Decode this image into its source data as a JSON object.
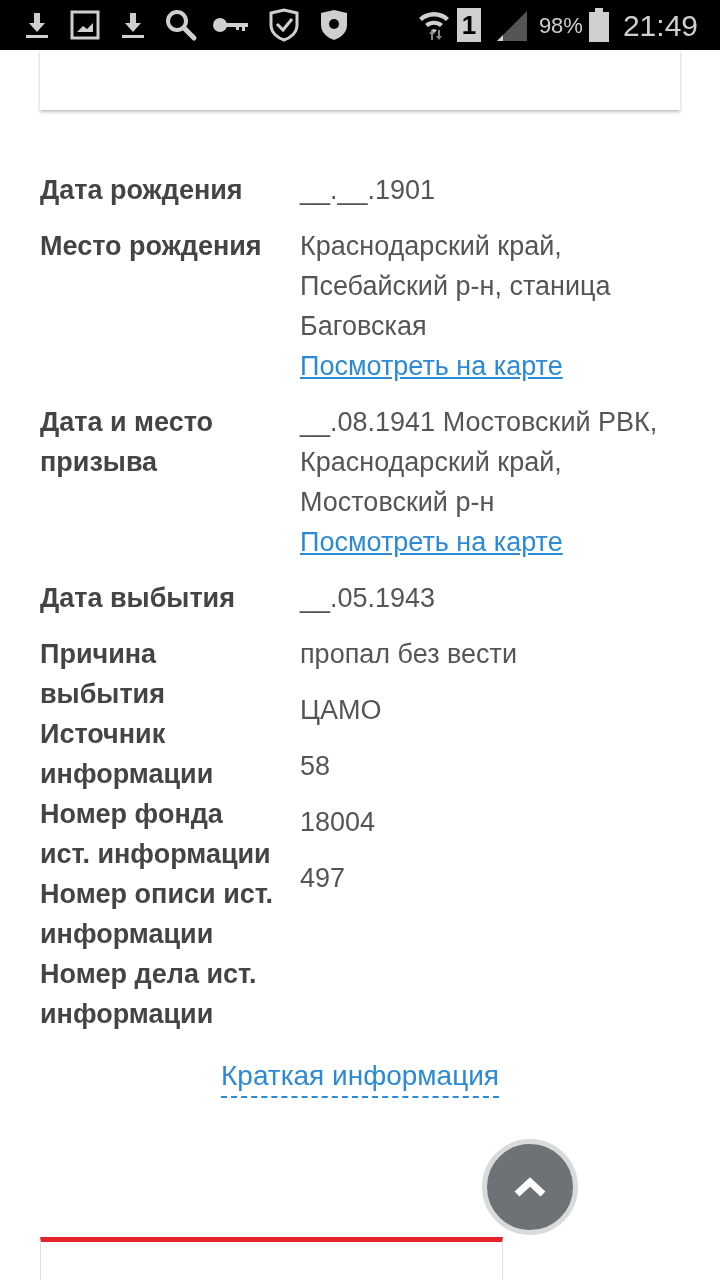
{
  "status_bar": {
    "sim_slot": "1",
    "battery": "98%",
    "time": "21:49"
  },
  "fields": [
    {
      "label": "Дата рождения",
      "value": "__.__.1901"
    },
    {
      "label": "Место рождения",
      "value": "Краснодарский край, Псебайский р-н, станица Баговская",
      "link": "Посмотреть на карте"
    },
    {
      "label": "Дата и место призыва",
      "value": "__.08.1941 Мостовский РВК, Краснодарский край, Мостовский р-н",
      "link": "Посмотреть на карте"
    },
    {
      "label": "Дата выбытия",
      "value": "__.05.1943"
    }
  ],
  "details": {
    "labels": [
      "Причина выбытия",
      "Источник информации",
      "Номер фонда ист. информации",
      "Номер описи ист. информации",
      "Номер дела ист. информации"
    ],
    "values": [
      "пропал без вести",
      "ЦАМО",
      "58",
      "18004",
      "497"
    ]
  },
  "summary_link": "Краткая информация"
}
